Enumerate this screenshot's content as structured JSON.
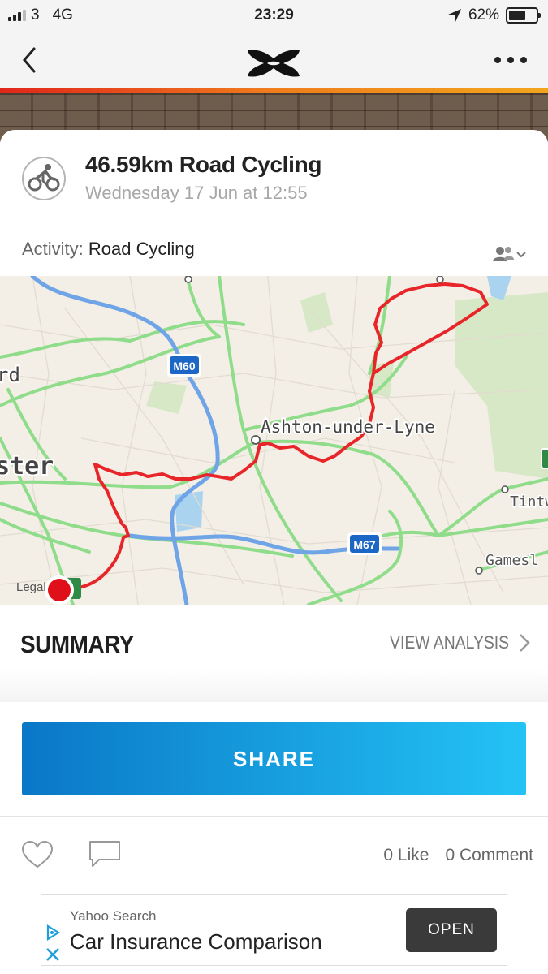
{
  "status_bar": {
    "carrier": "3",
    "network": "4G",
    "time": "23:29",
    "battery": "62%",
    "battery_level": 0.62
  },
  "header": {
    "back_icon": "chevron-left-icon",
    "logo": "under-armour-logo",
    "more_icon": "more-dots-icon"
  },
  "workout": {
    "title": "46.59km Road Cycling",
    "date": "Wednesday 17 Jun at 12:55",
    "activity_label": "Activity:",
    "activity_value": "Road Cycling",
    "privacy_icon": "friends-icon"
  },
  "map": {
    "labels": {
      "town": "Ashton-under-Lyne",
      "road_m60": "M60",
      "road_m67": "M67",
      "edge_left_top": "rd",
      "edge_left": "ster",
      "edge_right": "Tintw",
      "edge_right2": "Gamesl",
      "legal": "Legal"
    },
    "route_color": "#e8262a",
    "motorway_color": "#6fa4e6",
    "aroad_color": "#7fd67f"
  },
  "summary": {
    "heading": "SUMMARY",
    "view_analysis": "VIEW ANALYSIS"
  },
  "actions": {
    "share_label": "SHARE",
    "likes": "0 Like",
    "comments": "0 Comment"
  },
  "ad": {
    "source": "Yahoo Search",
    "headline": "Car Insurance Comparison",
    "button": "OPEN"
  }
}
